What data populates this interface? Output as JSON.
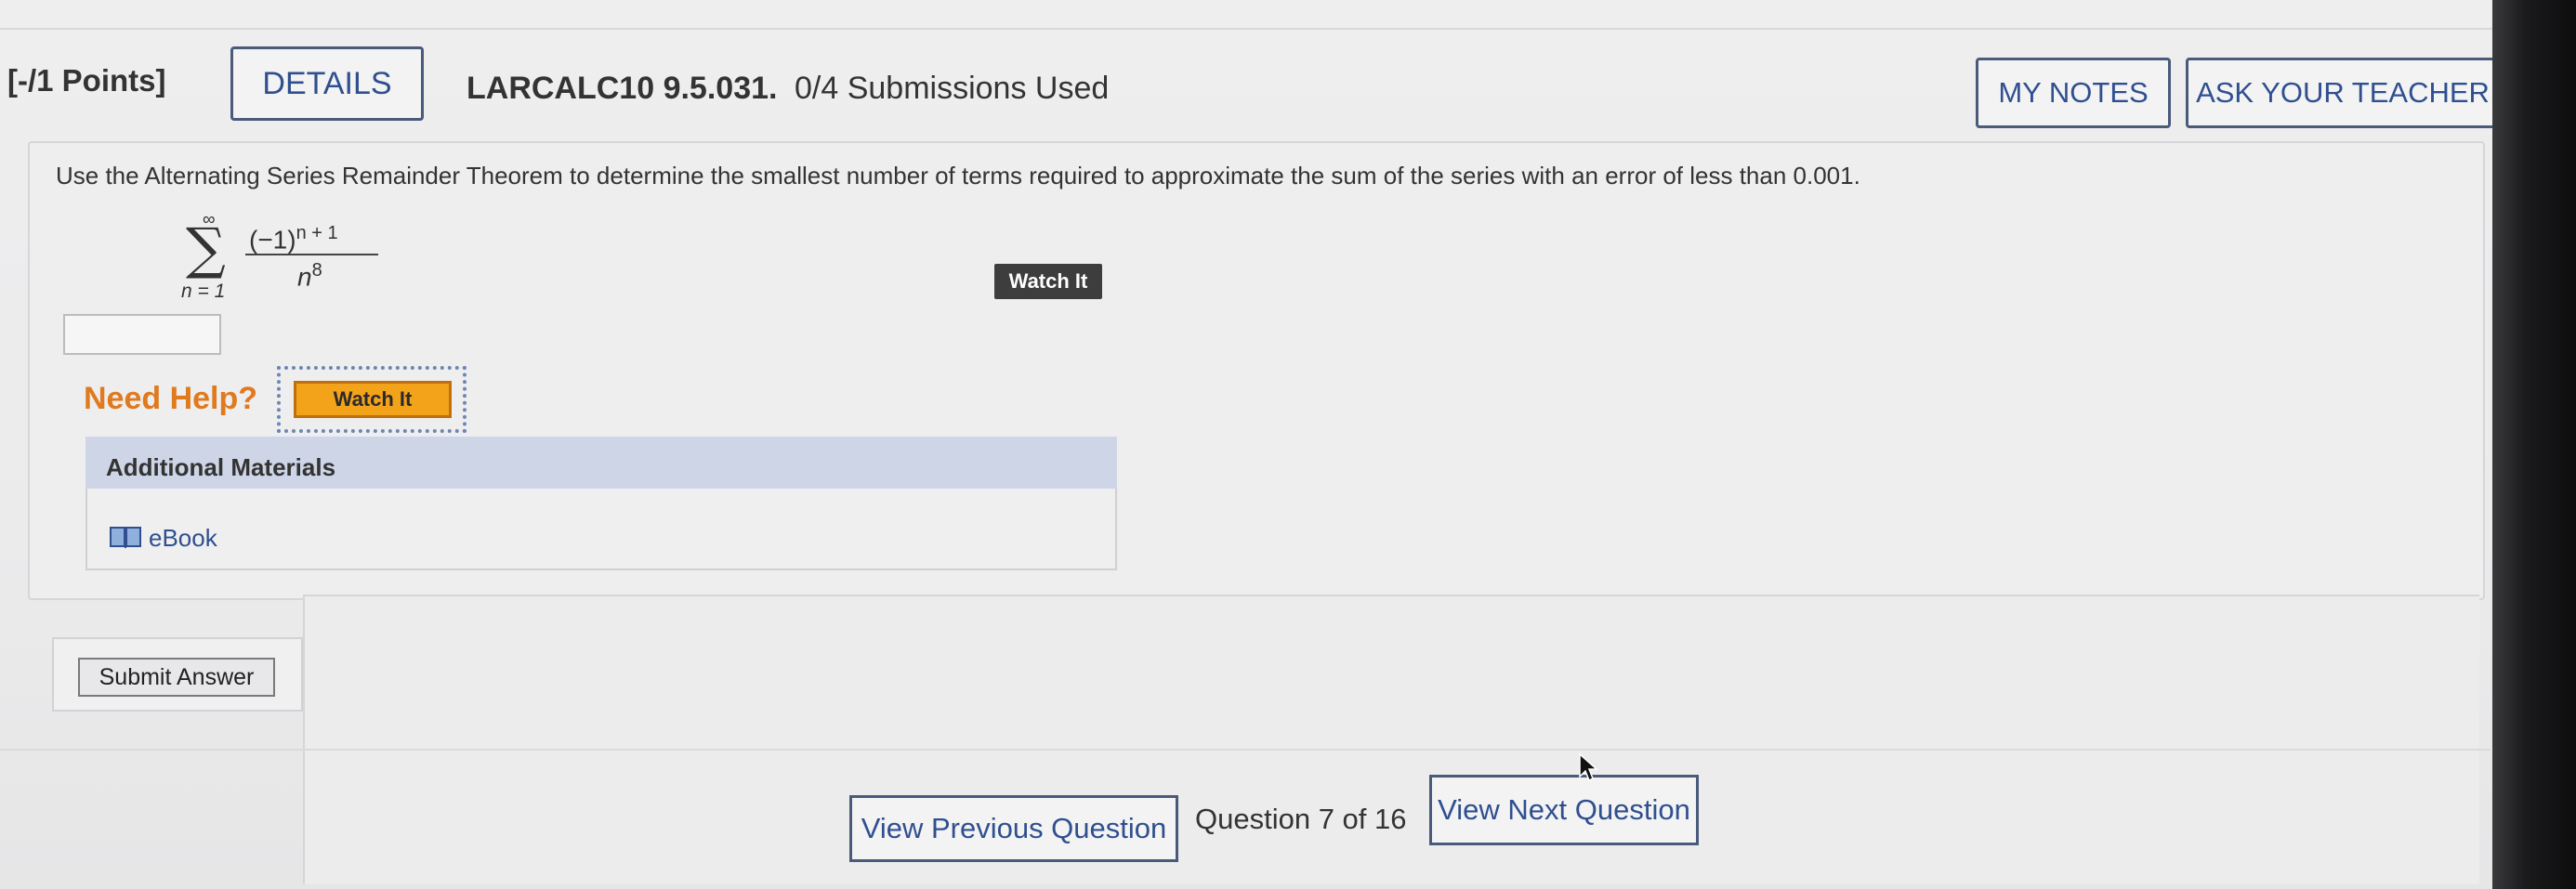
{
  "header": {
    "points": "[-/1 Points]",
    "details_label": "DETAILS",
    "question_id": "LARCALC10 9.5.031.",
    "submissions": "0/4 Submissions Used",
    "my_notes_label": "MY NOTES",
    "ask_teacher_label": "ASK YOUR TEACHER"
  },
  "question": {
    "prompt": "Use the Alternating Series Remainder Theorem to determine the smallest number of terms required to approximate the sum of the series with an error of less than 0.001.",
    "series": {
      "upper_limit": "∞",
      "lower_limit": "n = 1",
      "numerator_base": "(−1)",
      "numerator_exponent": "n + 1",
      "denominator_base": "n",
      "denominator_exponent": "8"
    },
    "watch_it_label": "Watch It",
    "answer_value": ""
  },
  "help": {
    "need_help": "Need Help?",
    "watch_it_label": "Watch It",
    "additional_materials": "Additional Materials",
    "ebook_label": "eBook",
    "ebook_icon": "book-icon"
  },
  "actions": {
    "submit_label": "Submit Answer"
  },
  "navigation": {
    "prev_label": "View Previous Question",
    "question_counter": "Question 7 of 16",
    "next_label": "View Next Question"
  },
  "colors": {
    "link_blue": "#2f4f8f",
    "need_help_orange": "#e07a1f",
    "watch_it_orange": "#f3a31a",
    "materials_header": "#cdd5e7"
  }
}
